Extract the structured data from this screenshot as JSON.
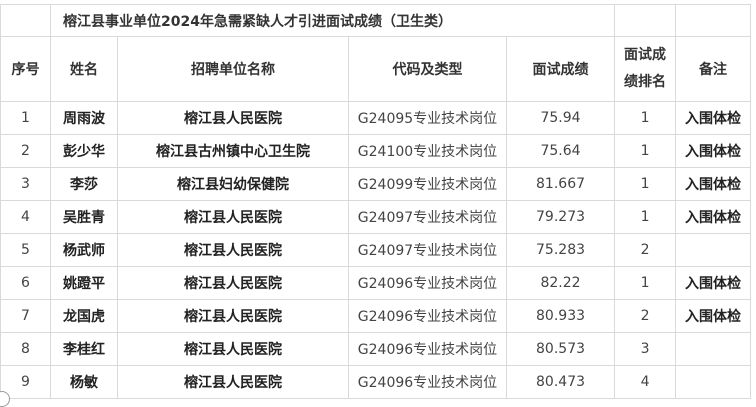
{
  "table": {
    "title": "榕江县事业单位2024年急需紧缺人才引进面试成绩（卫生类）",
    "headers": {
      "no": "序号",
      "name": "姓名",
      "unit": "招聘单位名称",
      "code": "代码及类型",
      "score": "面试成绩",
      "rank_line1": "面试成",
      "rank_line2": "绩排名",
      "remark": "备注"
    },
    "rows": [
      {
        "no": "1",
        "name": "周雨波",
        "unit": "榕江县人民医院",
        "code": "G24095专业技术岗位",
        "score": "75.94",
        "rank": "1",
        "remark": "入围体检"
      },
      {
        "no": "2",
        "name": "彭少华",
        "unit": "榕江县古州镇中心卫生院",
        "code": "G24100专业技术岗位",
        "score": "75.64",
        "rank": "1",
        "remark": "入围体检"
      },
      {
        "no": "3",
        "name": "李莎",
        "unit": "榕江县妇幼保健院",
        "code": "G24099专业技术岗位",
        "score": "81.667",
        "rank": "1",
        "remark": "入围体检"
      },
      {
        "no": "4",
        "name": "吴胜青",
        "unit": "榕江县人民医院",
        "code": "G24097专业技术岗位",
        "score": "79.273",
        "rank": "1",
        "remark": "入围体检"
      },
      {
        "no": "5",
        "name": "杨武师",
        "unit": "榕江县人民医院",
        "code": "G24097专业技术岗位",
        "score": "75.283",
        "rank": "2",
        "remark": ""
      },
      {
        "no": "6",
        "name": "姚蹬平",
        "unit": "榕江县人民医院",
        "code": "G24096专业技术岗位",
        "score": "82.22",
        "rank": "1",
        "remark": "入围体检"
      },
      {
        "no": "7",
        "name": "龙国虎",
        "unit": "榕江县人民医院",
        "code": "G24096专业技术岗位",
        "score": "80.933",
        "rank": "2",
        "remark": "入围体检"
      },
      {
        "no": "8",
        "name": "李桂红",
        "unit": "榕江县人民医院",
        "code": "G24096专业技术岗位",
        "score": "80.573",
        "rank": "3",
        "remark": ""
      },
      {
        "no": "9",
        "name": "杨敏",
        "unit": "榕江县人民医院",
        "code": "G24096专业技术岗位",
        "score": "80.473",
        "rank": "4",
        "remark": ""
      }
    ]
  }
}
